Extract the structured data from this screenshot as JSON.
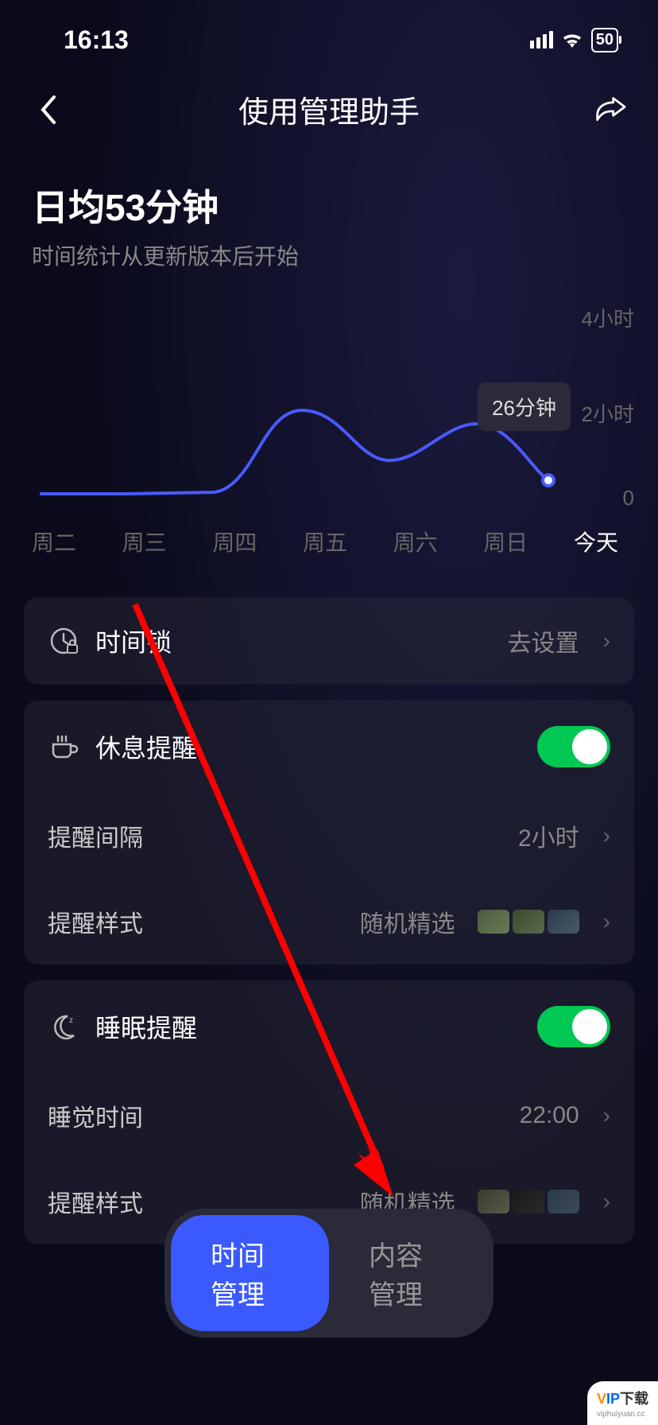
{
  "statusBar": {
    "time": "16:13",
    "battery": "50"
  },
  "nav": {
    "title": "使用管理助手"
  },
  "stats": {
    "title": "日均53分钟",
    "subtitle": "时间统计从更新版本后开始"
  },
  "chart_data": {
    "type": "line",
    "categories": [
      "周二",
      "周三",
      "周四",
      "周五",
      "周六",
      "周日",
      "今天"
    ],
    "values": [
      10,
      10,
      30,
      105,
      50,
      95,
      26
    ],
    "ylabel_unit": "小时",
    "ylim": [
      0,
      240
    ],
    "y_ticks": [
      "4小时",
      "2小时",
      "0"
    ],
    "tooltip": "26分钟",
    "highlighted_category": "今天"
  },
  "settings": {
    "timeLock": {
      "label": "时间锁",
      "action": "去设置"
    },
    "restReminder": {
      "label": "休息提醒",
      "enabled": true,
      "interval": {
        "label": "提醒间隔",
        "value": "2小时"
      },
      "style": {
        "label": "提醒样式",
        "value": "随机精选"
      }
    },
    "sleepReminder": {
      "label": "睡眠提醒",
      "enabled": true,
      "sleepTime": {
        "label": "睡觉时间",
        "value": "22:00"
      },
      "style": {
        "label": "提醒样式",
        "value": "随机精选"
      }
    }
  },
  "tabs": {
    "time": "时间管理",
    "content": "内容管理"
  },
  "watermark": {
    "brand_v": "V",
    "brand_ip": "IP",
    "suffix": "下载",
    "url": "viphuiyuan.cc"
  }
}
